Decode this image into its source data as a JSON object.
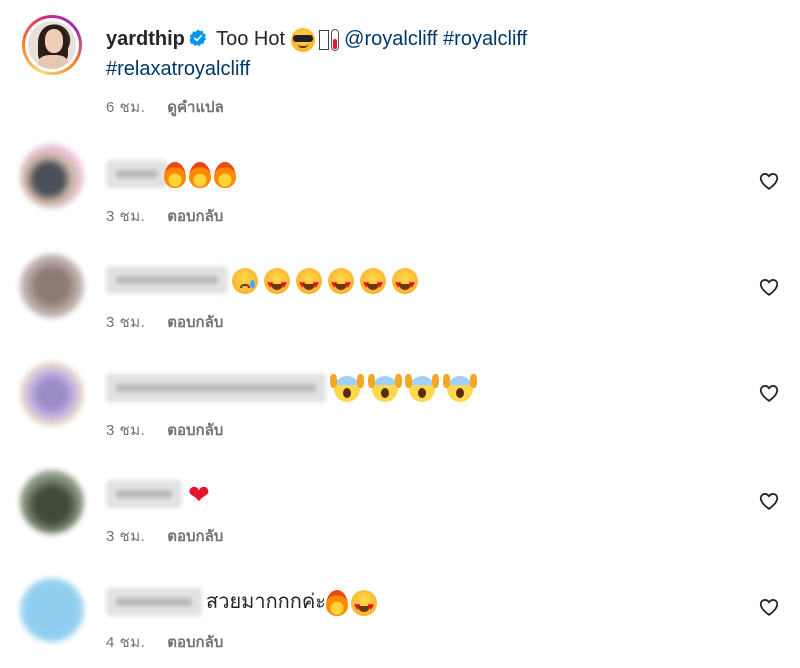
{
  "caption": {
    "username": "yardthip",
    "text_lead": "Too Hot",
    "mention": "@royalcliff",
    "hashtags": [
      "#royalcliff",
      "#relaxatroyalcliff"
    ],
    "time": "6 ชม.",
    "translate_label": "ดูคำแปล",
    "icons": [
      "verified-badge-icon",
      "sunglasses-face-emoji",
      "unsupported-glyph-box",
      "thermometer-emoji"
    ]
  },
  "reply_label": "ตอบกลับ",
  "comments": [
    {
      "time": "3 ชม.",
      "text": "",
      "emojis": [
        "fire",
        "fire",
        "fire"
      ]
    },
    {
      "time": "3 ชม.",
      "text": "",
      "emojis": [
        "sad-tear-face",
        "heart-eyes",
        "heart-eyes",
        "heart-eyes",
        "heart-eyes",
        "heart-eyes"
      ]
    },
    {
      "time": "3 ชม.",
      "text": "",
      "emojis": [
        "screaming-face",
        "screaming-face",
        "screaming-face",
        "screaming-face"
      ]
    },
    {
      "time": "3 ชม.",
      "text": "",
      "emojis": [
        "red-heart"
      ]
    },
    {
      "time": "4 ชม.",
      "text": "สวยมากกกค่ะ",
      "emojis": [
        "fire",
        "heart-eyes"
      ]
    }
  ],
  "colors": {
    "text": "#262626",
    "muted": "#737373",
    "link": "#00376b",
    "verified": "#0095f6"
  }
}
